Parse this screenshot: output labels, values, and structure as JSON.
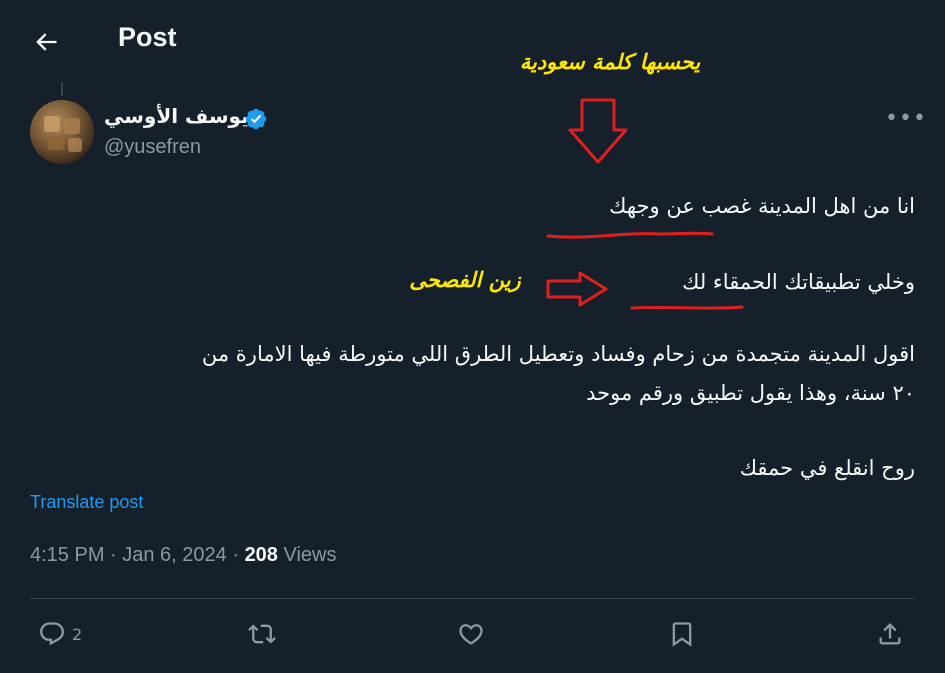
{
  "header": {
    "title": "Post"
  },
  "author": {
    "display_name": "يوسف الأوسي",
    "handle": "@yusefren"
  },
  "annotations": {
    "top": "يحسبها كلمة سعودية",
    "side": "زين الفصحى",
    "color": "#ffe500",
    "marker_color": "#e0201e"
  },
  "tweet": {
    "line1": "انا من اهل المدينة غصب  عن وجهك",
    "line2": "وخلي تطبيقاتك الحمقاء لك",
    "line3": "اقول المدينة متجمدة من زحام وفساد وتعطيل الطرق اللي متورطة فيها الامارة من",
    "line4": "٢٠ سنة، وهذا يقول تطبيق ورقم موحد",
    "line5": "روح انقلع في حمقك"
  },
  "translate_label": "Translate post",
  "meta": {
    "time_date": "4:15 PM · Jan 6, 2024 · ",
    "views_count": "208",
    "views_label": " Views"
  },
  "actions": {
    "reply_count": "2"
  },
  "colors": {
    "background": "#15202b",
    "accent": "#1d9bf0",
    "muted": "#8b98a5"
  }
}
